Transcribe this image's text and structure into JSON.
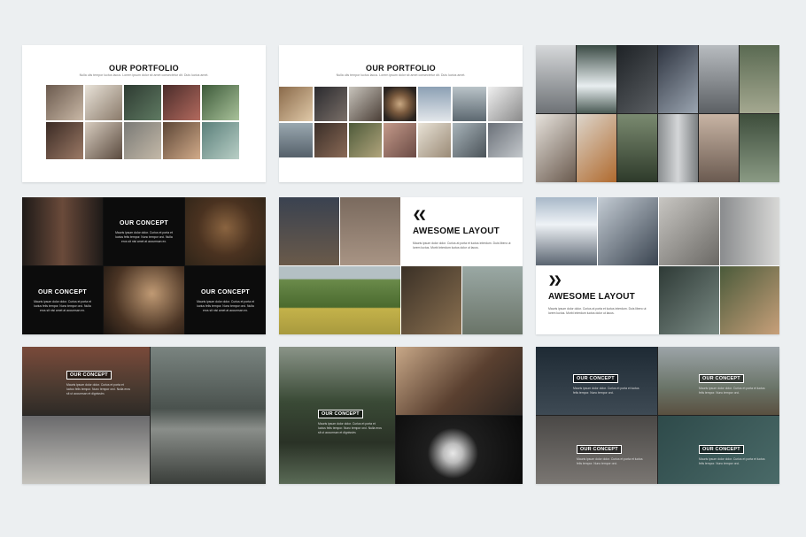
{
  "slides": {
    "s1": {
      "title": "OUR PORTFOLIO",
      "sub": "Nulla ulis tempor luctus lacus. Lorem ipsum dolor sit amet consectetur dit. Duis luctus amet."
    },
    "s2": {
      "title": "OUR PORTFOLIO",
      "sub": "Nulla ulis tempor luctus lacus. Lorem ipsum dolor sit amet consectetur dit. Duis luctus amet."
    },
    "s4": {
      "t1": "OUR CONCEPT",
      "t2": "OUR CONCEPT",
      "t3": "OUR CONCEPT",
      "body": "Mauris ipsum dolor dolor. Curius et porta et luctus felis tempor. Nunc tempor orci. Nulla eros sit nisi amet at accumsan ex."
    },
    "s5": {
      "title": "AWESOME LAYOUT",
      "body": "Mauris ipsum dolor dolor. Curius at porta et luctus interdum. Duis libero ut lorem luctus. Morbi interdum luctus dolor ut lacus."
    },
    "s6": {
      "title": "AWESOME LAYOUT",
      "body": "Mauris ipsum dolor dolor. Curius at porta et luctus interdum. Duis libero ut lorem luctus. Morbi interdum luctus dolor ut lacus."
    },
    "s7": {
      "t": "OUR CONCEPT",
      "body": "Mauris ipsum dolor dolor. Curius et porta et luctus felis tempor. Nunc tempor orci. Nulla eros sit ut accumsan et dignissim."
    },
    "s8": {
      "t": "OUR CONCEPT",
      "body": "Mauris ipsum dolor dolor. Curius et porta et luctus felis tempor. Nunc tempor orci. Nulla eros sit ut accumsan et dignissim."
    },
    "s9": {
      "t1": "OUR CONCEPT",
      "t2": "OUR CONCEPT",
      "t3": "OUR CONCEPT",
      "t4": "OUR CONCEPT",
      "body": "Mauris ipsum dolor dolor. Curius et porta et luctus felis tempor. Nunc tempor orci."
    }
  }
}
